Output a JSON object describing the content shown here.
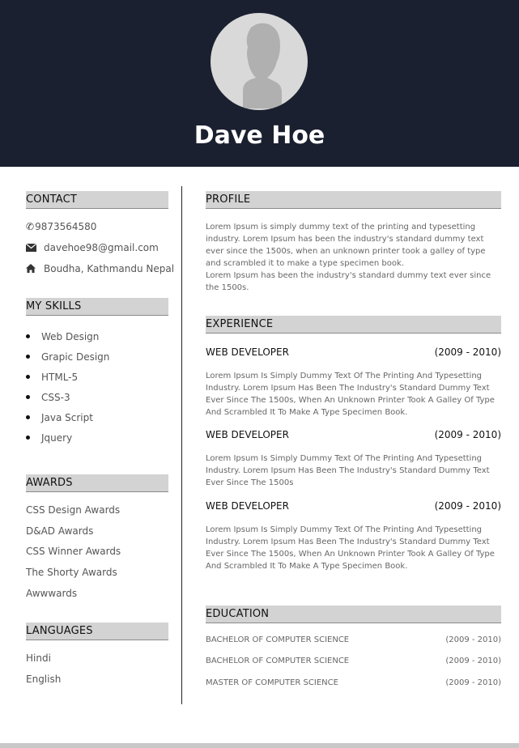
{
  "header": {
    "name": "Dave Hoe",
    "header_color": "#1b2030"
  },
  "contact": {
    "heading": "CONTACT",
    "phone": "9873564580",
    "email": "davehoe98@gmail.com",
    "address": "Boudha, Kathmandu Nepal"
  },
  "skills": {
    "heading": "MY SKILLS",
    "items": [
      "Web Design",
      "Grapic Design",
      "HTML-5",
      "CSS-3",
      "Java Script",
      "Jquery"
    ]
  },
  "awards": {
    "heading": "AWARDS",
    "items": [
      "CSS Design Awards",
      "D&AD Awards",
      "CSS Winner Awards",
      "The Shorty Awards",
      "Awwwards"
    ]
  },
  "languages": {
    "heading": "LANGUAGES",
    "items": [
      "Hindi",
      "English"
    ]
  },
  "profile": {
    "heading": "PROFILE",
    "text1": "Lorem Ipsum is simply dummy text of the printing and typesetting industry. Lorem Ipsum has been the industry's standard dummy text ever since the 1500s, when an unknown printer took a galley of type and scrambled it to make a type specimen book.",
    "text2": "Lorem Ipsum has been the industry's standard dummy text ever since the 1500s."
  },
  "experience": {
    "heading": "EXPERIENCE",
    "jobs": [
      {
        "title": "WEB DEVELOPER",
        "date": "(2009 - 2010)",
        "desc": "Lorem Ipsum Is Simply Dummy Text Of The Printing And Typesetting Industry. Lorem Ipsum Has Been The Industry's Standard Dummy Text Ever Since The 1500s, When An Unknown Printer Took A Galley Of Type And Scrambled It To Make A Type Specimen Book."
      },
      {
        "title": "WEB DEVELOPER",
        "date": "(2009 - 2010)",
        "desc": "Lorem Ipsum Is Simply Dummy Text Of The Printing And Typesetting Industry. Lorem Ipsum Has Been The Industry's Standard Dummy Text Ever Since The 1500s"
      },
      {
        "title": "WEB DEVELOPER",
        "date": "(2009 - 2010)",
        "desc": "Lorem Ipsum Is Simply Dummy Text Of The Printing And Typesetting Industry. Lorem Ipsum Has Been The Industry's Standard Dummy Text Ever Since The 1500s, When An Unknown Printer Took A Galley Of Type And Scrambled It To Make A Type Specimen Book."
      }
    ]
  },
  "education": {
    "heading": "EDUCATION",
    "items": [
      {
        "degree": "BACHELOR OF COMPUTER SCIENCE",
        "date": "(2009 - 2010)"
      },
      {
        "degree": "BACHELOR OF COMPUTER SCIENCE",
        "date": "(2009 - 2010)"
      },
      {
        "degree": "MASTER OF COMPUTER SCIENCE",
        "date": "(2009 - 2010)"
      }
    ]
  }
}
